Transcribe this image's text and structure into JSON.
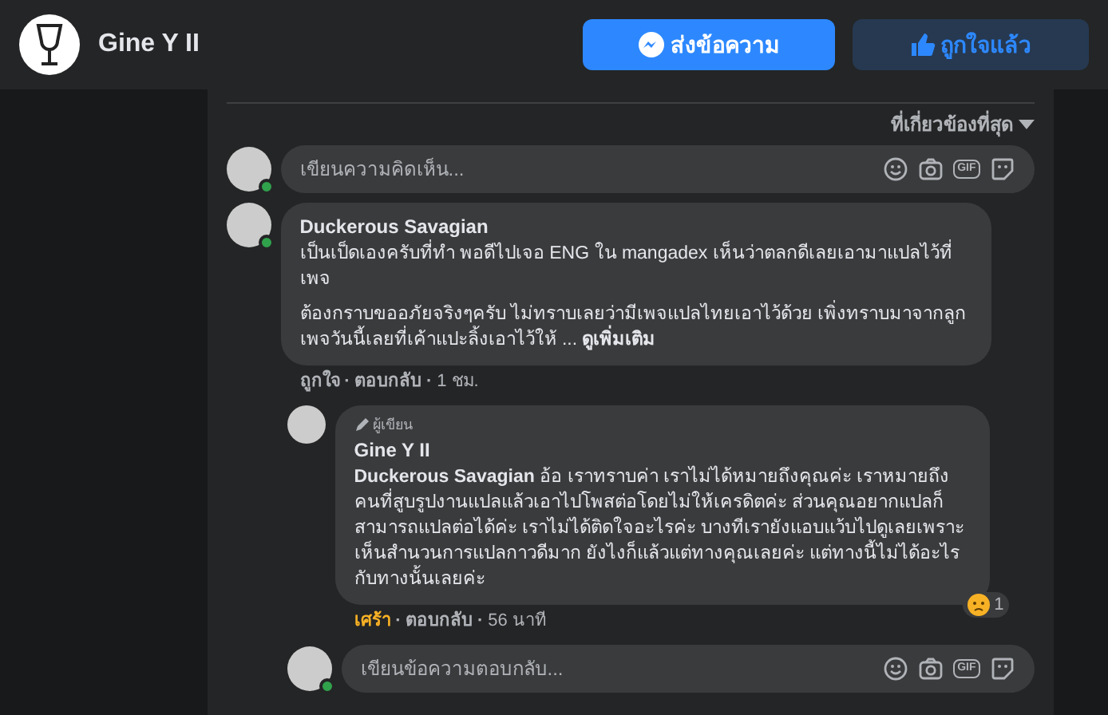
{
  "page": {
    "name": "Gine Y II"
  },
  "buttons": [
    {
      "label": "ส่งข้อความ",
      "kind": "message"
    },
    {
      "label": "ถูกใจแล้ว",
      "kind": "liked"
    }
  ],
  "sort": {
    "label": "ที่เกี่ยวข้องที่สุด"
  },
  "separator": "·",
  "comment_box": {
    "placeholder": "เขียนความคิดเห็น...",
    "online": true,
    "gif_label": "GIF"
  },
  "comments": [
    {
      "author": "Duckerous Savagian",
      "online": true,
      "paragraphs": [
        "เป็นเป็ดเองครับที่ทำ พอดีไปเจอ ENG ใน mangadex เห็นว่าตลกดีเลยเอามาแปลไว้ที่เพจ",
        "ต้องกราบขออภัยจริงๆครับ ไม่ทราบเลยว่ามีเพจแปลไทยเอาไว้ด้วย เพิ่งทราบมาจากลูกเพจวันนี้เลยที่เค้าแปะลิ้งเอาไว้ให้ ... **ดูเพิ่มเติม**"
      ],
      "reaction": {
        "label": "ถูกใจ",
        "kind": "none"
      },
      "reply": "ตอบกลับ",
      "time": "1 ชม.",
      "replies": [
        {
          "badge": "ผู้เขียน",
          "author": "Gine Y II",
          "online": false,
          "paragraphs": [
            "**Duckerous Savagian** อ้อ เราทราบค่า เราไม่ได้หมายถึงคุณค่ะ เราหมายถึงคนที่สูบรูปงานแปลแล้วเอาไปโพสต่อโดยไม่ให้เครดิตค่ะ ส่วนคุณอยากแปลก็สามารถแปลต่อได้ค่ะ เราไม่ได้ติดใจอะไรค่ะ บางทีเรายังแอบแว้บไปดูเลยเพราะเห็นสำนวนการแปลกาวดีมาก ยังไงก็แล้วแต่ทางคุณเลยค่ะ แต่ทางนี้ไม่ได้อะไรกับทางนั้นเลยค่ะ"
          ],
          "reaction": {
            "label": "เศร้า",
            "kind": "sad"
          },
          "reply": "ตอบกลับ",
          "time": "56 นาที",
          "reaction_count": "1"
        }
      ]
    }
  ],
  "reply_box": {
    "placeholder": "เขียนข้อความตอบกลับ...",
    "online": true,
    "gif_label": "GIF"
  }
}
